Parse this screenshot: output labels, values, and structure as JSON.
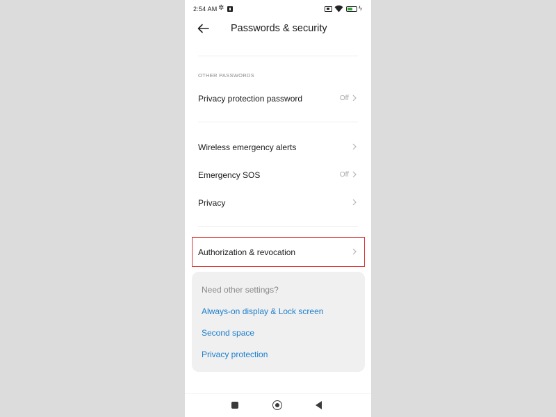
{
  "status_bar": {
    "time": "2:54 AM",
    "icons": [
      "settings-gear-icon",
      "notification-icon",
      "sim-icon",
      "wifi-icon",
      "battery-icon",
      "charging-icon"
    ],
    "battery_color": "#3aa23a"
  },
  "header": {
    "back_icon": "arrow-left-icon",
    "title": "Passwords & security"
  },
  "sections": {
    "other_passwords_label": "OTHER PASSWORDS"
  },
  "rows": [
    {
      "label": "Privacy protection password",
      "value": "Off"
    },
    {
      "label": "Wireless emergency alerts",
      "value": ""
    },
    {
      "label": "Emergency SOS",
      "value": "Off"
    },
    {
      "label": "Privacy",
      "value": ""
    },
    {
      "label": "Authorization & revocation",
      "value": ""
    }
  ],
  "suggestions": {
    "title": "Need other settings?",
    "links": [
      "Always-on display & Lock screen",
      "Second space",
      "Privacy protection"
    ]
  },
  "colors": {
    "link": "#1c7fcc",
    "highlight_border": "#d93a3a",
    "card_bg": "#f0f0f0",
    "outer_bg": "#dcdcdc"
  },
  "nav_bar": {
    "icons": [
      "recents-square-icon",
      "home-circle-icon",
      "back-triangle-icon"
    ]
  }
}
